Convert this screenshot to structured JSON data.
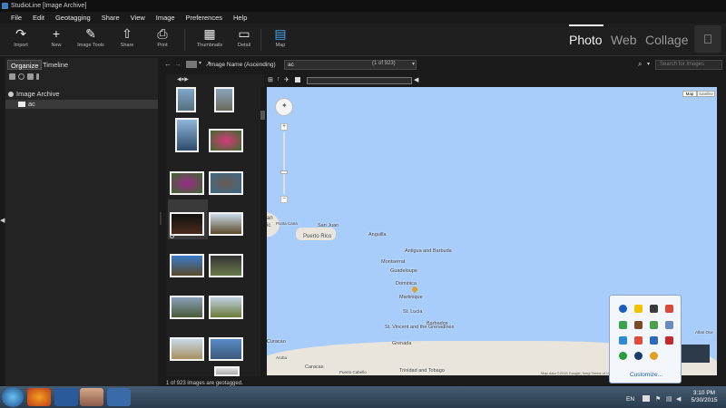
{
  "window": {
    "title": "StudioLine [Image Archive]"
  },
  "menu": [
    "File",
    "Edit",
    "Geotagging",
    "Share",
    "View",
    "Image",
    "Preferences",
    "Help"
  ],
  "toolbar": {
    "buttons": [
      {
        "label": "Import",
        "icon": "import-icon"
      },
      {
        "label": "New",
        "icon": "plus-icon"
      },
      {
        "label": "Image Tools",
        "icon": "image-tools-icon"
      },
      {
        "label": "Share",
        "icon": "share-icon"
      },
      {
        "label": "Print",
        "icon": "print-icon"
      },
      {
        "label": "Thumbnails",
        "icon": "thumbnails-icon"
      },
      {
        "label": "Detail",
        "icon": "detail-icon"
      },
      {
        "label": "Map",
        "icon": "map-icon"
      }
    ],
    "modes": [
      "Photo",
      "Web",
      "Collage"
    ],
    "active_mode": "Photo"
  },
  "left_panel": {
    "tabs": [
      "Organize",
      "Timeline"
    ],
    "active_tab": "Organize",
    "tree": [
      {
        "label": "Image Archive",
        "level": 0
      },
      {
        "label": "ac",
        "level": 1,
        "selected": true
      }
    ]
  },
  "browser": {
    "sort": "Image Name (Ascending)",
    "filter_value": "ac",
    "counter": "(1 of 923)",
    "search_placeholder": "Search for Images"
  },
  "map": {
    "type_buttons": [
      "Map",
      "Satellite"
    ],
    "places": [
      "San Juan",
      "Puerto Rico",
      "Anguilla",
      "Antigua and Barbuda",
      "Montserrat",
      "Guadeloupe",
      "Dominica",
      "Martinique",
      "St. Lucia",
      "Barbados",
      "St. Vincent and the Grenadines",
      "Grenada",
      "Curacao",
      "Caracas",
      "Trinidad and Tobago",
      "Puerto Cabello",
      "Atlan Oce"
    ],
    "attribution": "Map data ©2015 Google, Inegi Terms of Use"
  },
  "status": {
    "text": "1 of 923 images are geotagged."
  },
  "tray_popup": {
    "customize_label": "Customize..."
  },
  "taskbar": {
    "language": "EN",
    "time": "3:10 PM",
    "date": "5/30/2015"
  }
}
